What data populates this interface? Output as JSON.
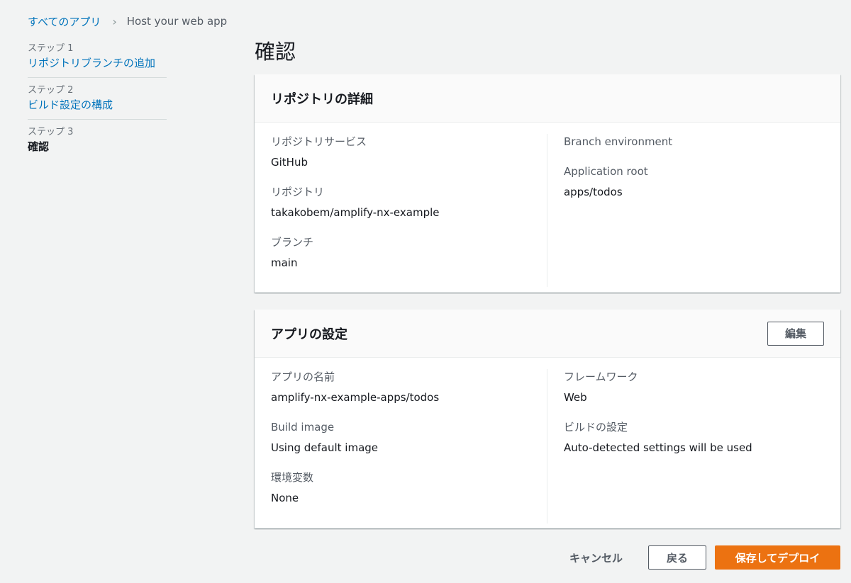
{
  "breadcrumb": {
    "root": "すべてのアプリ",
    "separator": "›",
    "current": "Host your web app"
  },
  "steps": [
    {
      "label": "ステップ 1",
      "title": "リポジトリブランチの追加"
    },
    {
      "label": "ステップ 2",
      "title": "ビルド設定の構成"
    },
    {
      "label": "ステップ 3",
      "title": "確認"
    }
  ],
  "page_title": "確認",
  "repo_panel": {
    "title": "リポジトリの詳細",
    "left": [
      {
        "label": "リポジトリサービス",
        "value": "GitHub"
      },
      {
        "label": "リポジトリ",
        "value": "takakobem/amplify-nx-example"
      },
      {
        "label": "ブランチ",
        "value": "main"
      }
    ],
    "right": [
      {
        "label": "Branch environment",
        "value": ""
      },
      {
        "label": "Application root",
        "value": "apps/todos"
      }
    ]
  },
  "app_panel": {
    "title": "アプリの設定",
    "edit_label": "編集",
    "left": [
      {
        "label": "アプリの名前",
        "value": "amplify-nx-example-apps/todos"
      },
      {
        "label": "Build image",
        "value": "Using default image"
      },
      {
        "label": "環境変数",
        "value": "None"
      }
    ],
    "right": [
      {
        "label": "フレームワーク",
        "value": "Web"
      },
      {
        "label": "ビルドの設定",
        "value": "Auto-detected settings will be used"
      }
    ]
  },
  "actions": {
    "cancel": "キャンセル",
    "back": "戻る",
    "save_deploy": "保存してデプロイ"
  },
  "colors": {
    "link": "#0073bb",
    "primary": "#ec7211",
    "background": "#f2f3f3"
  }
}
